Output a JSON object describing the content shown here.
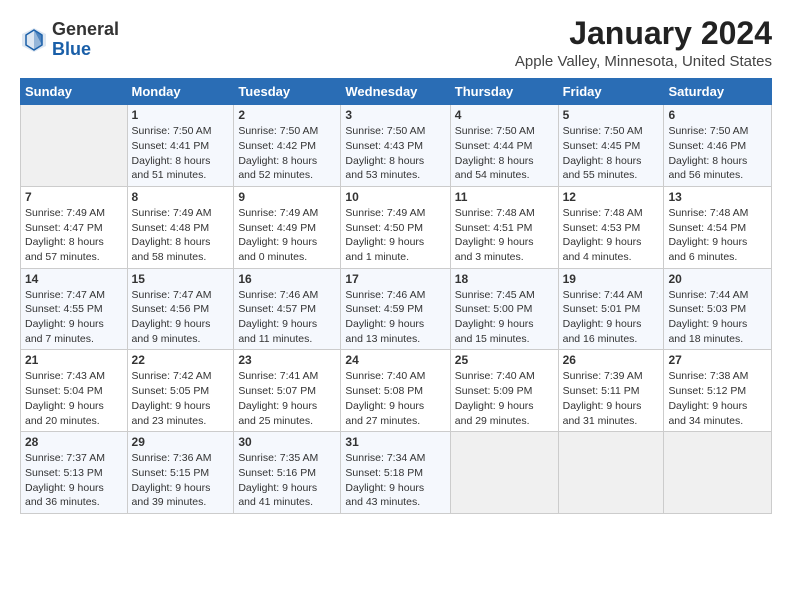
{
  "header": {
    "logo_general": "General",
    "logo_blue": "Blue",
    "month_title": "January 2024",
    "location": "Apple Valley, Minnesota, United States"
  },
  "days_of_week": [
    "Sunday",
    "Monday",
    "Tuesday",
    "Wednesday",
    "Thursday",
    "Friday",
    "Saturday"
  ],
  "weeks": [
    [
      {
        "day": "",
        "info": ""
      },
      {
        "day": "1",
        "info": "Sunrise: 7:50 AM\nSunset: 4:41 PM\nDaylight: 8 hours\nand 51 minutes."
      },
      {
        "day": "2",
        "info": "Sunrise: 7:50 AM\nSunset: 4:42 PM\nDaylight: 8 hours\nand 52 minutes."
      },
      {
        "day": "3",
        "info": "Sunrise: 7:50 AM\nSunset: 4:43 PM\nDaylight: 8 hours\nand 53 minutes."
      },
      {
        "day": "4",
        "info": "Sunrise: 7:50 AM\nSunset: 4:44 PM\nDaylight: 8 hours\nand 54 minutes."
      },
      {
        "day": "5",
        "info": "Sunrise: 7:50 AM\nSunset: 4:45 PM\nDaylight: 8 hours\nand 55 minutes."
      },
      {
        "day": "6",
        "info": "Sunrise: 7:50 AM\nSunset: 4:46 PM\nDaylight: 8 hours\nand 56 minutes."
      }
    ],
    [
      {
        "day": "7",
        "info": "Sunrise: 7:49 AM\nSunset: 4:47 PM\nDaylight: 8 hours\nand 57 minutes."
      },
      {
        "day": "8",
        "info": "Sunrise: 7:49 AM\nSunset: 4:48 PM\nDaylight: 8 hours\nand 58 minutes."
      },
      {
        "day": "9",
        "info": "Sunrise: 7:49 AM\nSunset: 4:49 PM\nDaylight: 9 hours\nand 0 minutes."
      },
      {
        "day": "10",
        "info": "Sunrise: 7:49 AM\nSunset: 4:50 PM\nDaylight: 9 hours\nand 1 minute."
      },
      {
        "day": "11",
        "info": "Sunrise: 7:48 AM\nSunset: 4:51 PM\nDaylight: 9 hours\nand 3 minutes."
      },
      {
        "day": "12",
        "info": "Sunrise: 7:48 AM\nSunset: 4:53 PM\nDaylight: 9 hours\nand 4 minutes."
      },
      {
        "day": "13",
        "info": "Sunrise: 7:48 AM\nSunset: 4:54 PM\nDaylight: 9 hours\nand 6 minutes."
      }
    ],
    [
      {
        "day": "14",
        "info": "Sunrise: 7:47 AM\nSunset: 4:55 PM\nDaylight: 9 hours\nand 7 minutes."
      },
      {
        "day": "15",
        "info": "Sunrise: 7:47 AM\nSunset: 4:56 PM\nDaylight: 9 hours\nand 9 minutes."
      },
      {
        "day": "16",
        "info": "Sunrise: 7:46 AM\nSunset: 4:57 PM\nDaylight: 9 hours\nand 11 minutes."
      },
      {
        "day": "17",
        "info": "Sunrise: 7:46 AM\nSunset: 4:59 PM\nDaylight: 9 hours\nand 13 minutes."
      },
      {
        "day": "18",
        "info": "Sunrise: 7:45 AM\nSunset: 5:00 PM\nDaylight: 9 hours\nand 15 minutes."
      },
      {
        "day": "19",
        "info": "Sunrise: 7:44 AM\nSunset: 5:01 PM\nDaylight: 9 hours\nand 16 minutes."
      },
      {
        "day": "20",
        "info": "Sunrise: 7:44 AM\nSunset: 5:03 PM\nDaylight: 9 hours\nand 18 minutes."
      }
    ],
    [
      {
        "day": "21",
        "info": "Sunrise: 7:43 AM\nSunset: 5:04 PM\nDaylight: 9 hours\nand 20 minutes."
      },
      {
        "day": "22",
        "info": "Sunrise: 7:42 AM\nSunset: 5:05 PM\nDaylight: 9 hours\nand 23 minutes."
      },
      {
        "day": "23",
        "info": "Sunrise: 7:41 AM\nSunset: 5:07 PM\nDaylight: 9 hours\nand 25 minutes."
      },
      {
        "day": "24",
        "info": "Sunrise: 7:40 AM\nSunset: 5:08 PM\nDaylight: 9 hours\nand 27 minutes."
      },
      {
        "day": "25",
        "info": "Sunrise: 7:40 AM\nSunset: 5:09 PM\nDaylight: 9 hours\nand 29 minutes."
      },
      {
        "day": "26",
        "info": "Sunrise: 7:39 AM\nSunset: 5:11 PM\nDaylight: 9 hours\nand 31 minutes."
      },
      {
        "day": "27",
        "info": "Sunrise: 7:38 AM\nSunset: 5:12 PM\nDaylight: 9 hours\nand 34 minutes."
      }
    ],
    [
      {
        "day": "28",
        "info": "Sunrise: 7:37 AM\nSunset: 5:13 PM\nDaylight: 9 hours\nand 36 minutes."
      },
      {
        "day": "29",
        "info": "Sunrise: 7:36 AM\nSunset: 5:15 PM\nDaylight: 9 hours\nand 39 minutes."
      },
      {
        "day": "30",
        "info": "Sunrise: 7:35 AM\nSunset: 5:16 PM\nDaylight: 9 hours\nand 41 minutes."
      },
      {
        "day": "31",
        "info": "Sunrise: 7:34 AM\nSunset: 5:18 PM\nDaylight: 9 hours\nand 43 minutes."
      },
      {
        "day": "",
        "info": ""
      },
      {
        "day": "",
        "info": ""
      },
      {
        "day": "",
        "info": ""
      }
    ]
  ]
}
